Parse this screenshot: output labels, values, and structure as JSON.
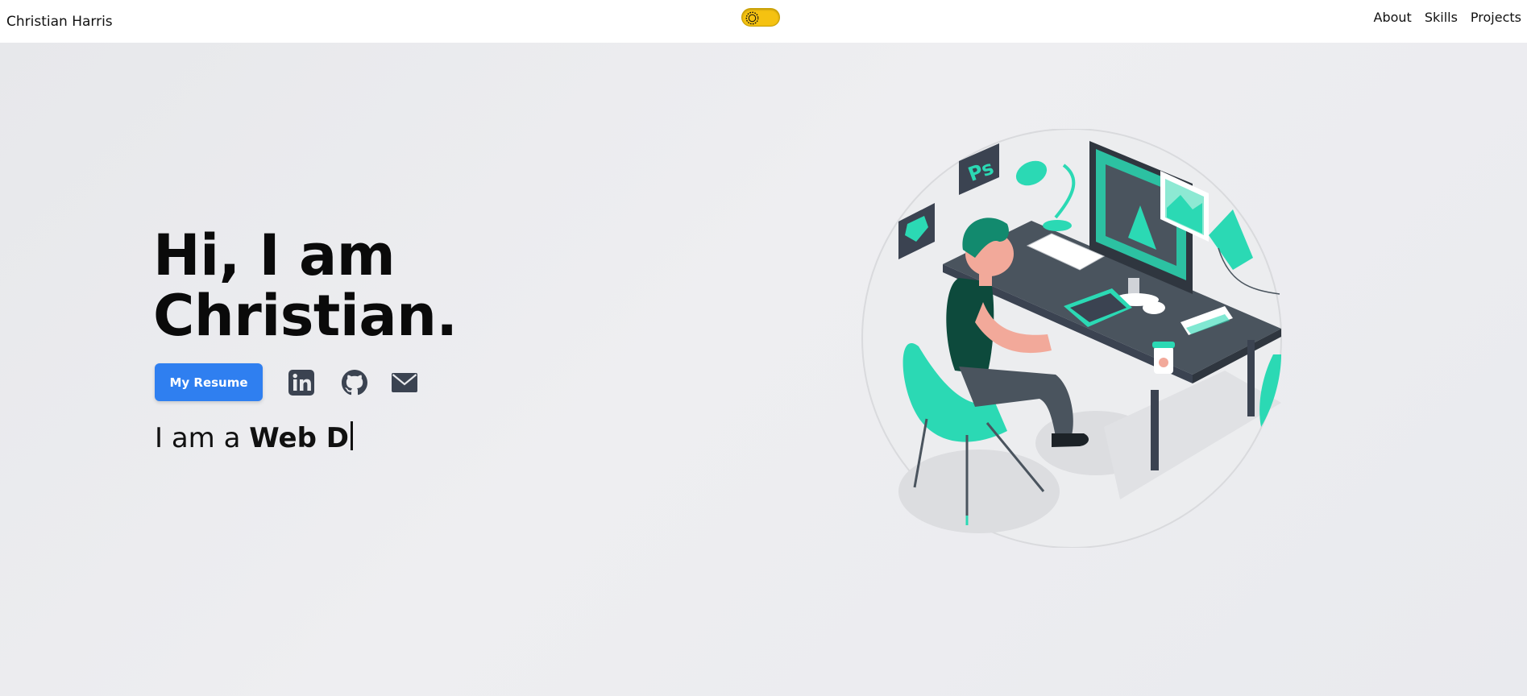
{
  "header": {
    "brand": "Christian Harris",
    "theme_toggle": {
      "icon": "sun-icon",
      "color": "#f5c211"
    },
    "nav": [
      {
        "label": "About"
      },
      {
        "label": "Skills"
      },
      {
        "label": "Projects"
      }
    ]
  },
  "hero": {
    "greeting_line1": "Hi, I am",
    "greeting_line2": "Christian.",
    "resume_button": "My Resume",
    "social_icons": [
      "linkedin-icon",
      "github-icon",
      "mail-icon"
    ],
    "typed_prefix": "I am a",
    "typed_role": "Web D",
    "accent_color": "#2f7ff0",
    "illustration_accent": "#2bd9b4"
  }
}
